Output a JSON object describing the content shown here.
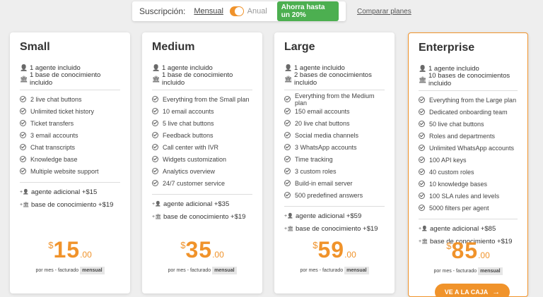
{
  "subscription": {
    "label": "Suscripción:",
    "monthly": "Mensual",
    "annual": "Anual",
    "discount": "Ahorra hasta un 20%",
    "compare": "Comparar planes"
  },
  "plans": [
    {
      "name": "Small",
      "included": [
        "1 agente incluido",
        "1 base de conocimiento incluido"
      ],
      "features": [
        "2 live chat buttons",
        "Unlimited ticket history",
        "Ticket transfers",
        "3 email accounts",
        "Chat transcripts",
        "Knowledge base",
        "Multiple website support"
      ],
      "addons": [
        "agente adicional +$15",
        "base de conocimiento +$19"
      ],
      "currency": "$",
      "price": "15",
      "decimals": ".00",
      "period": "por mes - facturado",
      "billing": "mensual"
    },
    {
      "name": "Medium",
      "included": [
        "1 agente incluido",
        "1 base de conocimiento incluido"
      ],
      "features": [
        "Everything from the Small plan",
        "10 email accounts",
        "5 live chat buttons",
        "Feedback buttons",
        "Call center with IVR",
        "Widgets customization",
        "Analytics overview",
        "24/7 customer service"
      ],
      "addons": [
        "agente adicional +$35",
        "base de conocimiento +$19"
      ],
      "currency": "$",
      "price": "35",
      "decimals": ".00",
      "period": "por mes - facturado",
      "billing": "mensual"
    },
    {
      "name": "Large",
      "included": [
        "1 agente incluido",
        "2 bases de conocimientos incluido"
      ],
      "features": [
        "Everything from the Medium plan",
        "150 email accounts",
        "20 live chat buttons",
        "Social media channels",
        "3 WhatsApp accounts",
        "Time tracking",
        "3 custom roles",
        "Build-in email server",
        "500 predefined answers"
      ],
      "addons": [
        "agente adicional +$59",
        "base de conocimiento +$19"
      ],
      "currency": "$",
      "price": "59",
      "decimals": ".00",
      "period": "por mes - facturado",
      "billing": "mensual"
    },
    {
      "name": "Enterprise",
      "included": [
        "1 agente incluido",
        "10 bases de conocimientos incluido"
      ],
      "features": [
        "Everything from the Large plan",
        "Dedicated onboarding team",
        "50 live chat buttons",
        "Roles and departments",
        "Unlimited WhatsApp accounts",
        "100 API keys",
        "40 custom roles",
        "10 knowledge bases",
        "100 SLA rules and levels",
        "5000 filters per agent"
      ],
      "addons": [
        "agente adicional +$85",
        "base de conocimiento +$19"
      ],
      "currency": "$",
      "price": "85",
      "decimals": ".00",
      "period": "por mes - facturado",
      "billing": "mensual",
      "cta": "VE A LA CAJA"
    }
  ],
  "colors": {
    "accent": "#f0932b",
    "discount": "#4caf50"
  },
  "icons": {
    "agent": "user-icon",
    "knowledge": "bank-icon",
    "feature": "check-circle-icon",
    "add_agent": "add-user-icon",
    "add_kb": "add-bank-icon",
    "cta": "arrow-right-icon"
  }
}
